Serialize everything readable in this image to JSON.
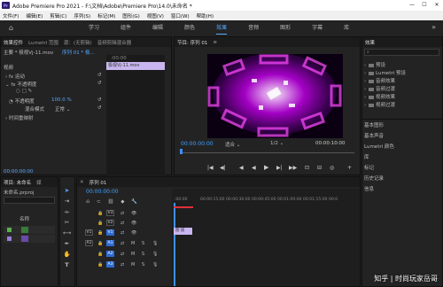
{
  "titlebar": {
    "app_icon": "Pr",
    "title": "Adobe Premiere Pro 2021 - F:\\文档\\Adobe\\Premiere Pro\\14.0\\未命名 *",
    "minimize": "—",
    "maximize": "☐",
    "close": "✕"
  },
  "menubar": [
    "文件(F)",
    "编辑(E)",
    "剪辑(C)",
    "序列(S)",
    "标记(M)",
    "图形(G)",
    "视图(V)",
    "窗口(W)",
    "帮助(H)"
  ],
  "workspaces": {
    "tabs": [
      "学习",
      "组件",
      "编辑",
      "颜色",
      "效果",
      "音频",
      "图形",
      "字幕",
      "库"
    ],
    "active": "效果",
    "more": "»"
  },
  "effect_controls": {
    "tabs": [
      "效果控件",
      "Lumetri 范围",
      "源：(无剪辑)",
      "音频剪辑混合器"
    ],
    "source_label": "主要 * 极视Vj-11.mov",
    "sequence_label": "序列 01 * 极...",
    "section_video": "视频",
    "fx_motion": "运动",
    "fx_opacity": "不透明度",
    "opacity_label": "不透明度",
    "opacity_value": "100.0 %",
    "blend_label": "混合模式",
    "blend_value": "正常",
    "time_remap": "时间重映射",
    "clip_bar": "极视Vj-11.mov",
    "ruler_tc": ":00:00",
    "current_tc": "00:00:00:00"
  },
  "program": {
    "tab": "节目: 序列 01",
    "menu_icon": "≡",
    "timecode": "00:00:00:00",
    "fit_label": "适合",
    "ratio": "1/2",
    "duration": "00:00:10:00",
    "controls": [
      "|◀",
      "◀|",
      "◀",
      "▶",
      "▶|",
      "▶▶",
      "⊡",
      "⊟",
      "◎",
      "+"
    ]
  },
  "effects_panel": {
    "tab": "效果",
    "search_placeholder": "⌕",
    "folders": [
      "预设",
      "Lumetri 预设",
      "音频效果",
      "音频过渡",
      "视频效果",
      "视频过渡"
    ],
    "side_items": [
      "基本图形",
      "基本声音",
      "Lumetri 颜色",
      "库",
      "标记",
      "历史记录",
      "信息"
    ]
  },
  "project": {
    "tabs": [
      "项目: 未命名",
      "媒"
    ],
    "file": "未命名.prproj",
    "count": "",
    "name_header": "名称",
    "items": [
      "",
      ""
    ]
  },
  "timeline": {
    "tab": "序列 01",
    "timecode": "00:00:00:00",
    "ruler": [
      ":00:00",
      "00:00:15:00",
      "00:00:30:00",
      "00:00:45:00",
      "00:01:00:00",
      "00:01:15:00",
      "00:0"
    ],
    "video_tracks": [
      "V3",
      "V2",
      "V1"
    ],
    "audio_tracks": [
      "A1",
      "A2",
      "A3"
    ],
    "source_v": "V1",
    "source_a": "A1",
    "clip_label": "图 极"
  },
  "watermark": "知乎 | 时尚玩家岳哥",
  "colors": {
    "accent": "#5aa8ff",
    "playhead": "#3f8fff",
    "clip": "#c9b6f0",
    "track_target": "#2d6bd6"
  }
}
